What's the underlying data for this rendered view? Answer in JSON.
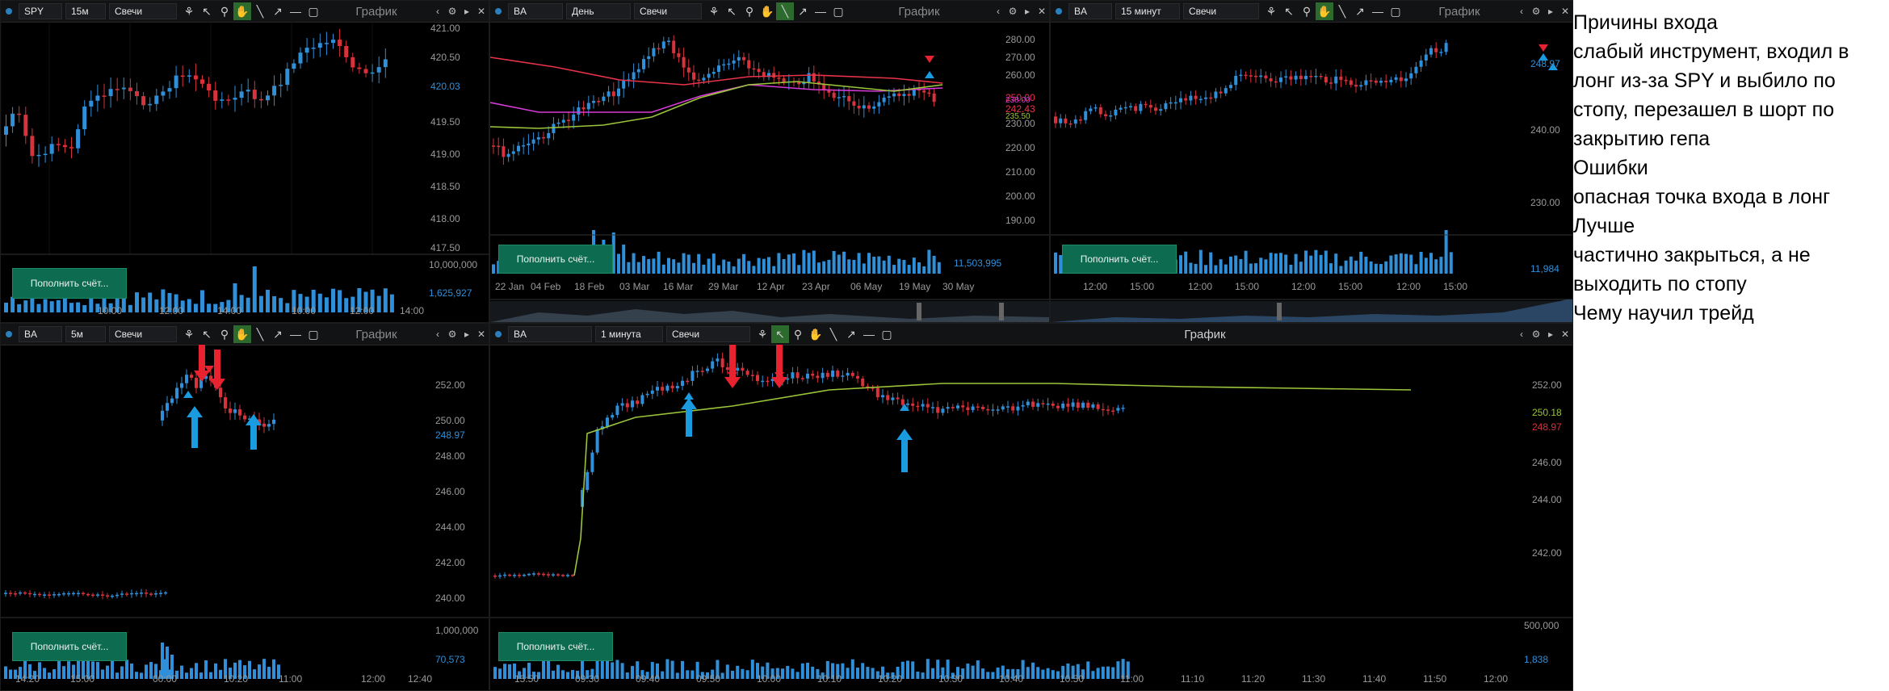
{
  "panels": [
    {
      "ticker": "SPY",
      "interval": "15м",
      "type": "Свечи",
      "title": "График",
      "topup": "Пополнить счёт...",
      "price_labels": [
        "421.00",
        "420.50",
        "420.03",
        "419.50",
        "419.00",
        "418.50",
        "418.00",
        "417.50"
      ],
      "vol_labels": [
        "10,000,000",
        "1,625,927"
      ],
      "time_labels": [
        "10:00",
        "12:00",
        "14:00",
        "10:00",
        "12:00",
        "14:00"
      ]
    },
    {
      "ticker": "BA",
      "interval": "День",
      "type": "Свечи",
      "title": "График",
      "topup": "Пополнить счёт...",
      "price_labels": [
        "280.00",
        "270.00",
        "260.00",
        "250.00",
        "242.43",
        "238.00",
        "235.50",
        "230.00",
        "220.00",
        "210.00",
        "200.00",
        "190.00"
      ],
      "vol_labels": [
        "11,503,995"
      ],
      "time_labels": [
        "22 Jan",
        "04 Feb",
        "18 Feb",
        "03 Mar",
        "16 Mar",
        "29 Mar",
        "12 Apr",
        "23 Apr",
        "06 May",
        "19 May",
        "30 May"
      ]
    },
    {
      "ticker": "BA",
      "interval": "15 минут",
      "type": "Свечи",
      "title": "График",
      "topup": "Пополнить счёт...",
      "price_labels": [
        "248.97",
        "240.00",
        "230.00"
      ],
      "vol_labels": [
        "11,984"
      ],
      "time_labels": [
        "12:00",
        "15:00",
        "12:00",
        "15:00",
        "12:00",
        "15:00",
        "12:00",
        "15:00"
      ]
    },
    {
      "ticker": "BA",
      "interval": "5м",
      "type": "Свечи",
      "title": "График",
      "topup": "Пополнить счёт...",
      "price_labels": [
        "252.00",
        "250.00",
        "248.97",
        "248.00",
        "246.00",
        "244.00",
        "242.00",
        "240.00"
      ],
      "vol_labels": [
        "1,000,000",
        "70,573"
      ],
      "time_labels": [
        "14:20",
        "15:00",
        "00:00",
        "10:20",
        "11:00",
        "12:00",
        "12:40"
      ]
    },
    {
      "ticker": "BA",
      "interval": "1 минута",
      "type": "Свечи",
      "title": "График",
      "topup": "Пополнить счёт...",
      "price_labels": [
        "252.00",
        "250.18",
        "248.97",
        "246.00",
        "244.00",
        "242.00"
      ],
      "vol_labels": [
        "500,000",
        "1,838"
      ],
      "time_labels": [
        "15:50",
        "09:30",
        "09:40",
        "09:50",
        "10:00",
        "10:10",
        "10:20",
        "10:30",
        "10:40",
        "10:50",
        "11:00",
        "11:10",
        "11:20",
        "11:30",
        "11:40",
        "11:50",
        "12:00"
      ]
    }
  ],
  "notes": {
    "line1": "Причины входа",
    "line2": "слабый инструмент, входил в",
    "line3": "лонг из-за SPY и выбило по",
    "line4": "стопу, перезашел в шорт по",
    "line5": "закрытию гепа",
    "line6": "Ошибки",
    "line7": "опасная точка входа в лонг",
    "line8": "Лучше",
    "line9": "частично закрыться, а не",
    "line10": "выходить по стопу",
    "line11": "Чему научил трейд"
  },
  "colors": {
    "up": "#2f8fd8",
    "down": "#d8323c",
    "ma_red": "#e8334a",
    "ma_green": "#9bc53a",
    "ma_magenta": "#d63ad6",
    "arrow_red": "#e8232f",
    "arrow_blue": "#1a9be0"
  }
}
